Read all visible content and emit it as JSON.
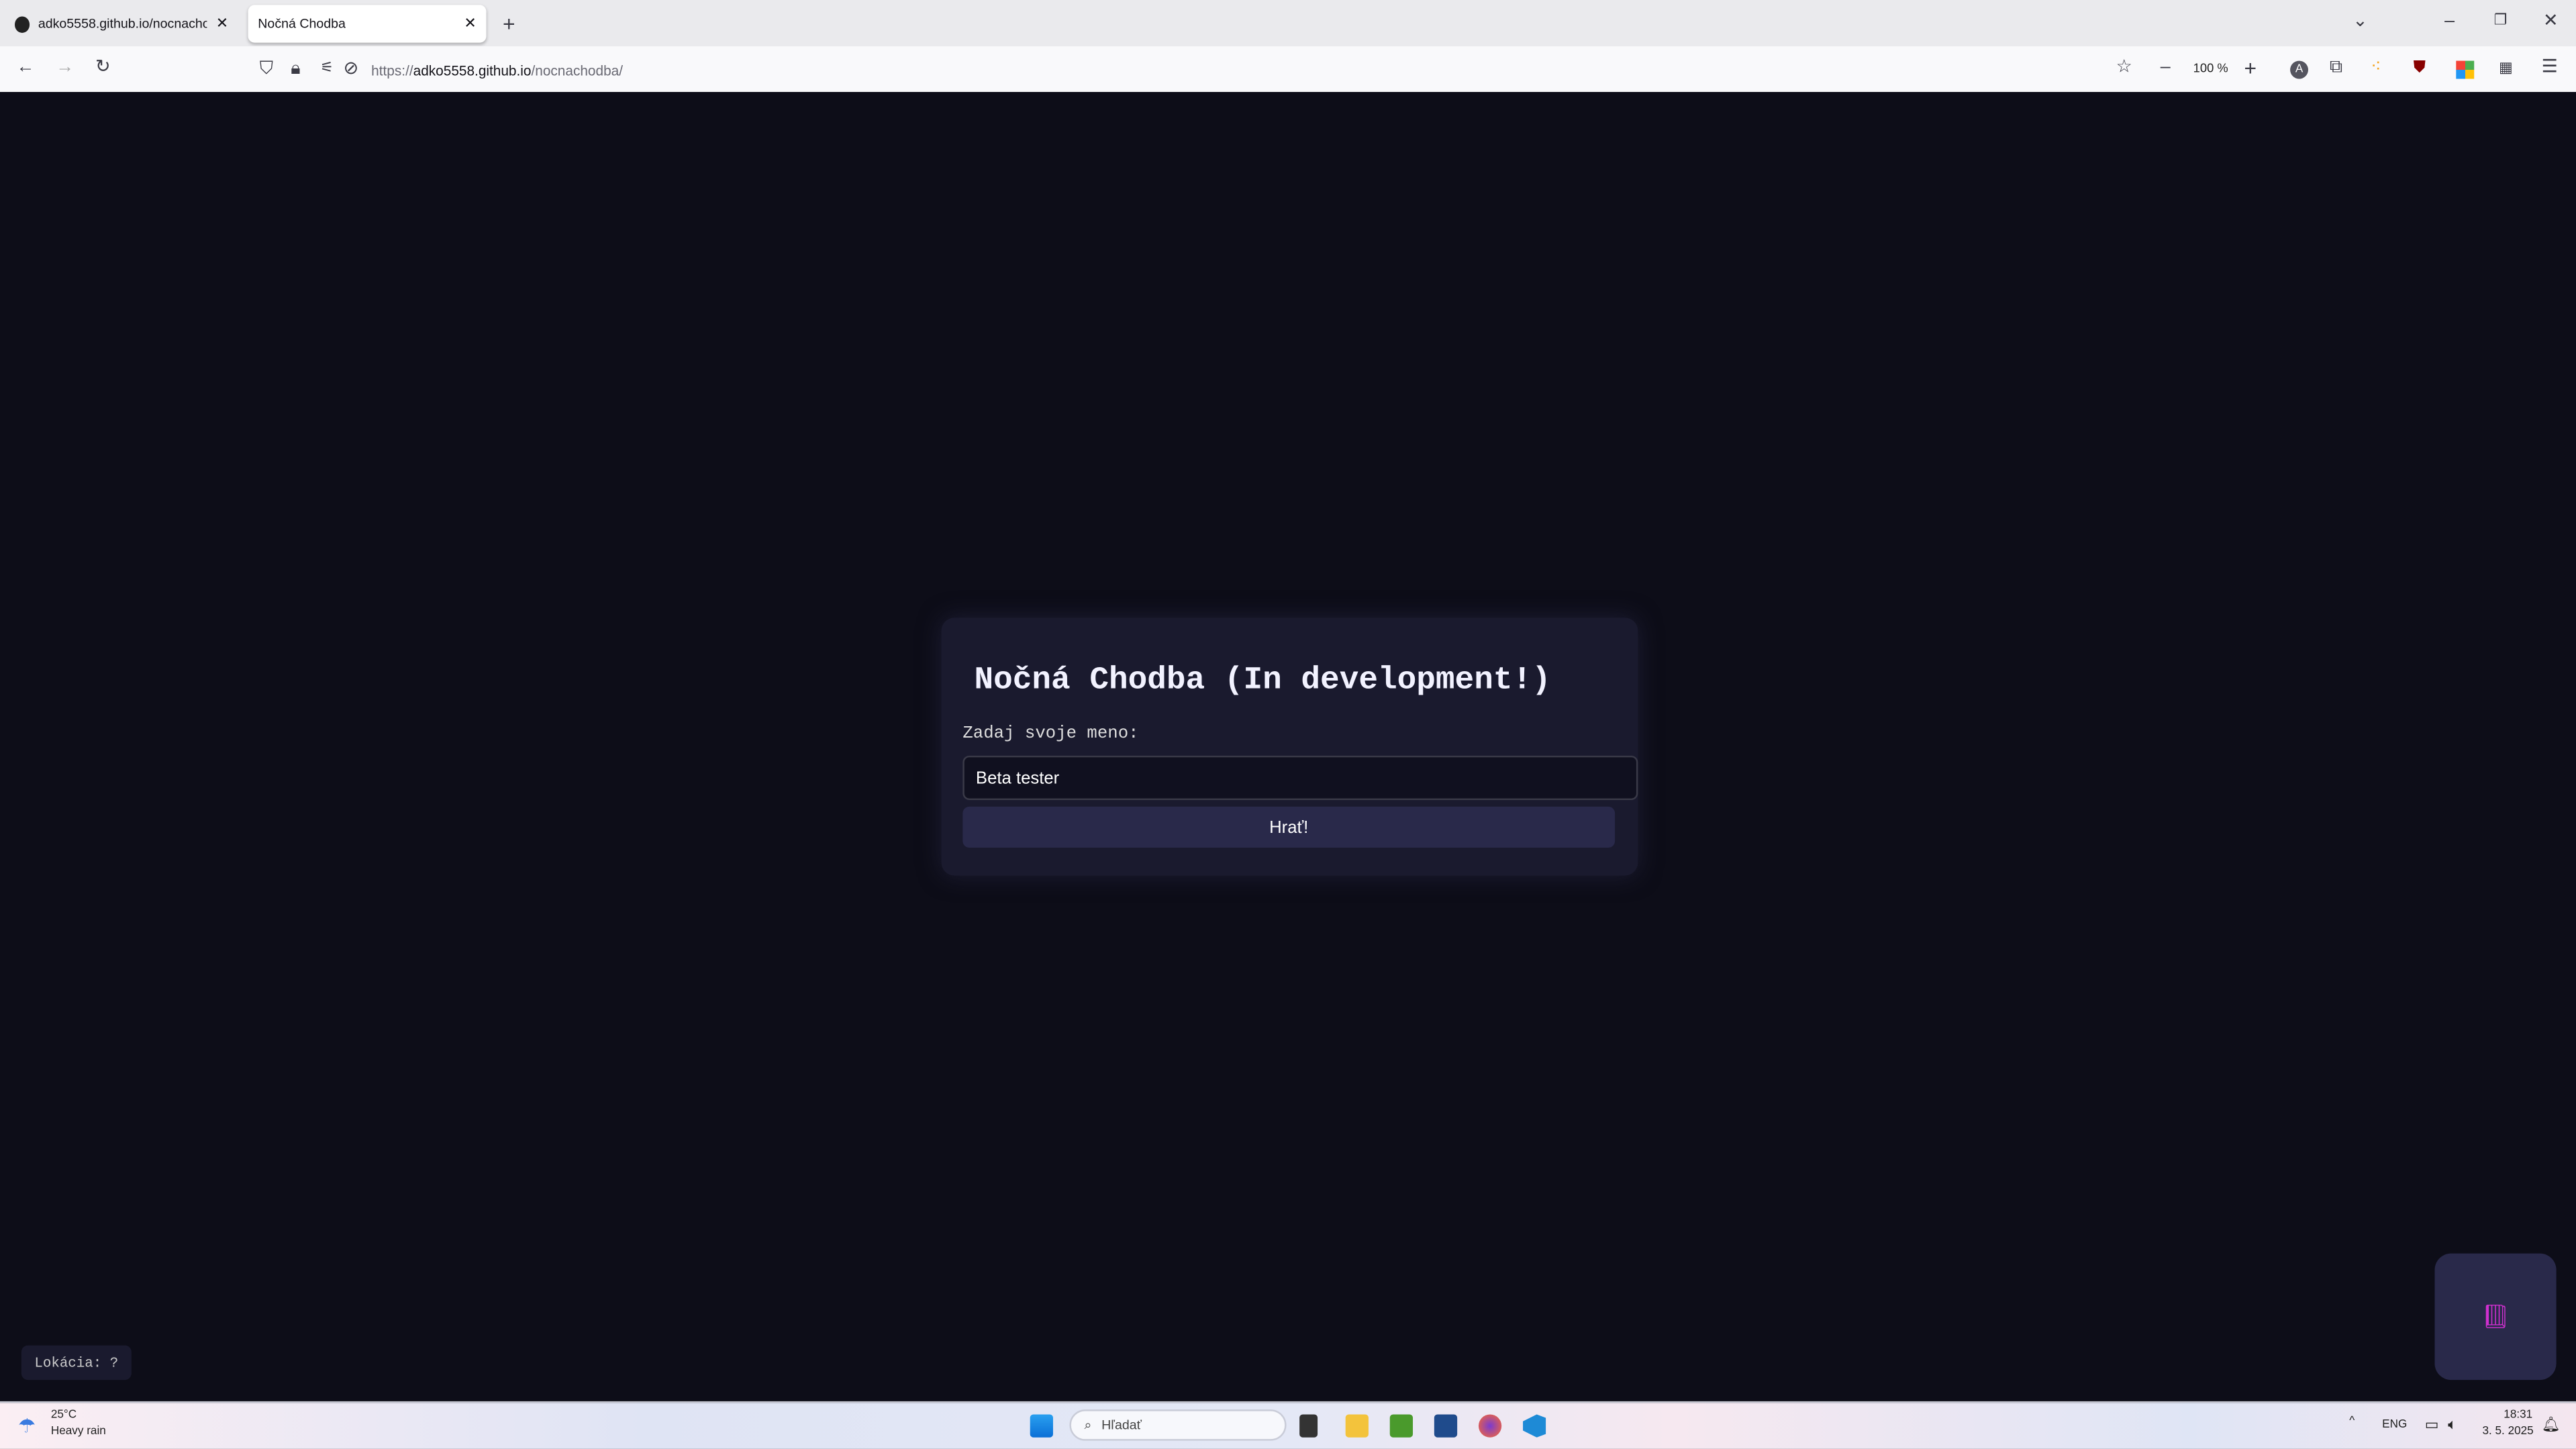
{
  "browser": {
    "tabs": [
      {
        "label": "adko5558.github.io/nocnachodba",
        "icon": "github-icon"
      },
      {
        "label": "Nočná Chodba",
        "active": true
      }
    ],
    "url_prefix": "https://",
    "url_domain": "adko5558.github.io",
    "url_path": "/nocnachodba/",
    "zoom": "100 %"
  },
  "page": {
    "title": "Nočná Chodba (In development!)",
    "name_label": "Zadaj svoje meno:",
    "name_value": "Beta tester",
    "play_button": "Hrať!",
    "location": "Lokácia: ?",
    "colors": {
      "background": "#0d0d18",
      "card": "#1a1a2e",
      "button": "#29294a"
    }
  },
  "taskbar": {
    "weather_temp": "25°C",
    "weather_desc": "Heavy rain",
    "search_placeholder": "Hľadať",
    "lang": "ENG",
    "time": "18:31",
    "date": "3. 5. 2025"
  }
}
